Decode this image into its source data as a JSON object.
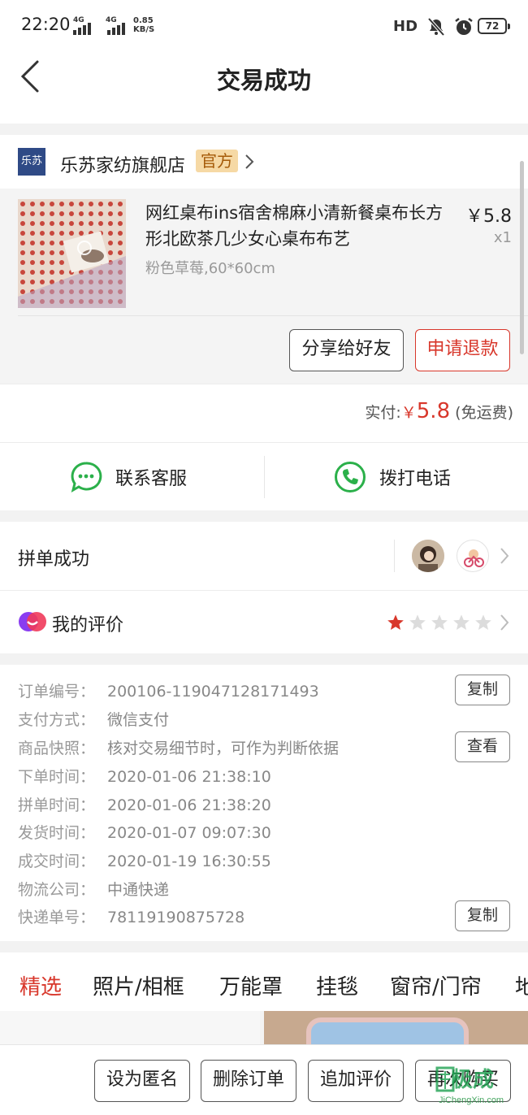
{
  "status_bar": {
    "time": "22:20",
    "net1": "4G",
    "net2": "4G",
    "speed_value": "0.85",
    "speed_unit": "KB/S",
    "hd": "HD",
    "battery": "72"
  },
  "nav": {
    "title": "交易成功",
    "back_icon": "chevron-left-icon"
  },
  "shop": {
    "logo_text": "乐苏",
    "name": "乐苏家纺旗舰店",
    "badge": "官方"
  },
  "goods": {
    "title": "网红桌布ins宿舍棉麻小清新餐桌布长方形北欧茶几少女心桌布布艺",
    "spec": "粉色草莓,60*60cm",
    "price": "￥5.8",
    "qty": "x1",
    "share_button": "分享给好友",
    "refund_button": "申请退款"
  },
  "payment": {
    "label": "实付:",
    "currency": "￥",
    "amount": "5.8",
    "note": "(免运费)"
  },
  "contact": {
    "service": "联系客服",
    "phone": "拨打电话"
  },
  "group": {
    "label": "拼单成功"
  },
  "review": {
    "label": "我的评价",
    "rating": 1,
    "max": 5
  },
  "order_info": {
    "copy_button": "复制",
    "view_button": "查看",
    "rows": [
      {
        "key": "订单编号：",
        "value": "200106-119047128171493"
      },
      {
        "key": "支付方式：",
        "value": "微信支付"
      },
      {
        "key": "商品快照：",
        "value": "核对交易细节时，可作为判断依据"
      },
      {
        "key": "下单时间：",
        "value": "2020-01-06 21:38:10"
      },
      {
        "key": "拼单时间：",
        "value": "2020-01-06 21:38:20"
      },
      {
        "key": "发货时间：",
        "value": "2020-01-07 09:07:30"
      },
      {
        "key": "成交时间：",
        "value": "2020-01-19 16:30:55"
      },
      {
        "key": "物流公司：",
        "value": "中通快递"
      },
      {
        "key": "快递单号：",
        "value": "78119190875728"
      }
    ]
  },
  "categories": [
    "精选",
    "照片/相框",
    "万能罩",
    "挂毯",
    "窗帘/门帘",
    "地"
  ],
  "bottom_actions": [
    "设为匿名",
    "删除订单",
    "追加评价",
    "再次购买"
  ],
  "watermark": {
    "brand": "极成",
    "url": "JiChengXin.com"
  },
  "colors": {
    "accent": "#d8372b",
    "badge_bg": "#f6d9a5",
    "badge_text": "#a55a08",
    "green": "#2bb04a"
  }
}
